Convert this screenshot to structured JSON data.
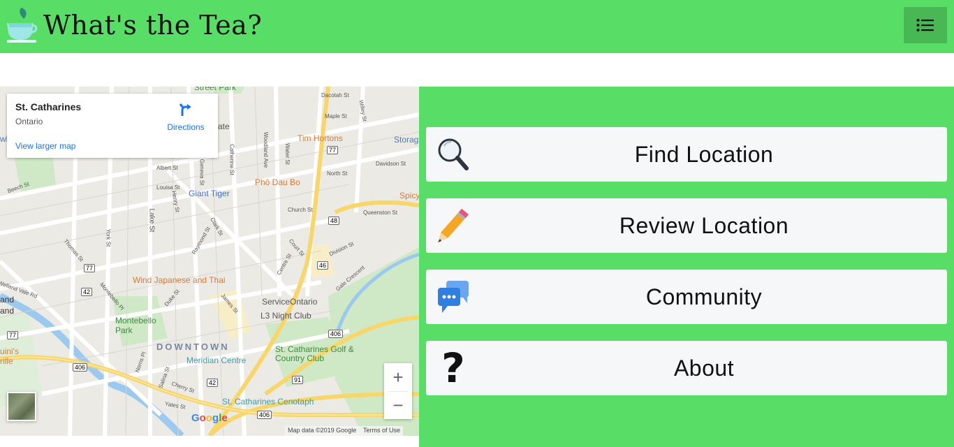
{
  "header": {
    "title": "What's the Tea?",
    "bg_color": "#58dd66",
    "menu_icon": "list-icon"
  },
  "map": {
    "info_card": {
      "place": "St. Catharines",
      "region": "Ontario",
      "directions_label": "Directions",
      "larger_map_link": "View larger map"
    },
    "labels": [
      "Street Park",
      "Dacotah St",
      "Maple St",
      "Tim Hortons",
      "Storag",
      "Davidson St",
      "North St",
      "Phô Dau Bo",
      "Spicy",
      "Queenston St",
      "Giant Tiger",
      "Church St",
      "Albert St",
      "Louisa St",
      "Lake St",
      "York St",
      "Beech St",
      "Wind Japanese and Thai",
      "ServiceOntario",
      "L3 Night Club",
      "Montebello Park",
      "DOWNTOWN",
      "Meridian Centre",
      "St. Catharines Golf & Country Club",
      "St. Catharines Cenotaph",
      "Gale Crescent",
      "Division St",
      "Court St",
      "James St",
      "Welland Vale Rd",
      "Yates St",
      "Cherry St",
      "Geneva St",
      "Ontario St",
      "Catherine St",
      "Woodland Ave",
      "Chaplin Ave",
      "Clark St",
      "Thomas St",
      "Montebello Pl",
      "Duke St",
      "Salina St",
      "Norris Pl",
      "Henry St",
      "Raymond St",
      "Centre St",
      "Water St",
      "Willey St",
      "ate",
      "wl",
      "and",
      "and",
      "uini's",
      "rille"
    ],
    "route_shields": [
      "77",
      "48",
      "46",
      "42",
      "77",
      "406",
      "406",
      "91",
      "42",
      "406",
      "77",
      "406"
    ],
    "zoom_in": "+",
    "zoom_out": "−",
    "google_logo": "Google",
    "attribution": "Map data ©2019 Google",
    "terms": "Terms of Use"
  },
  "menu": {
    "bg_color": "#58dd66",
    "items": [
      {
        "label": "Find Location",
        "icon": "magnifier-icon"
      },
      {
        "label": "Review Location",
        "icon": "pencil-icon"
      },
      {
        "label": "Community",
        "icon": "chat-bubbles-icon"
      },
      {
        "label": "About",
        "icon": "question-mark-icon"
      }
    ]
  }
}
